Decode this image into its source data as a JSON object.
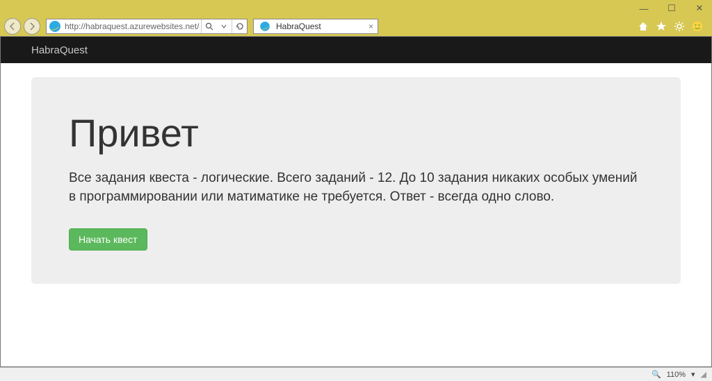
{
  "window": {
    "minimize": "—",
    "maximize": "☐",
    "close": "✕"
  },
  "browser": {
    "url": "http://habraquest.azurewebsites.net/#/",
    "tab_title": "HabraQuest",
    "zoom": "110%"
  },
  "page": {
    "brand": "HabraQuest",
    "heading": "Привет",
    "body": "Все задания квеста - логические. Всего заданий - 12. До 10 задания никаких особых умений в программировании или матиматике не требуется. Ответ - всегда одно слово.",
    "cta": "Начать квест"
  }
}
